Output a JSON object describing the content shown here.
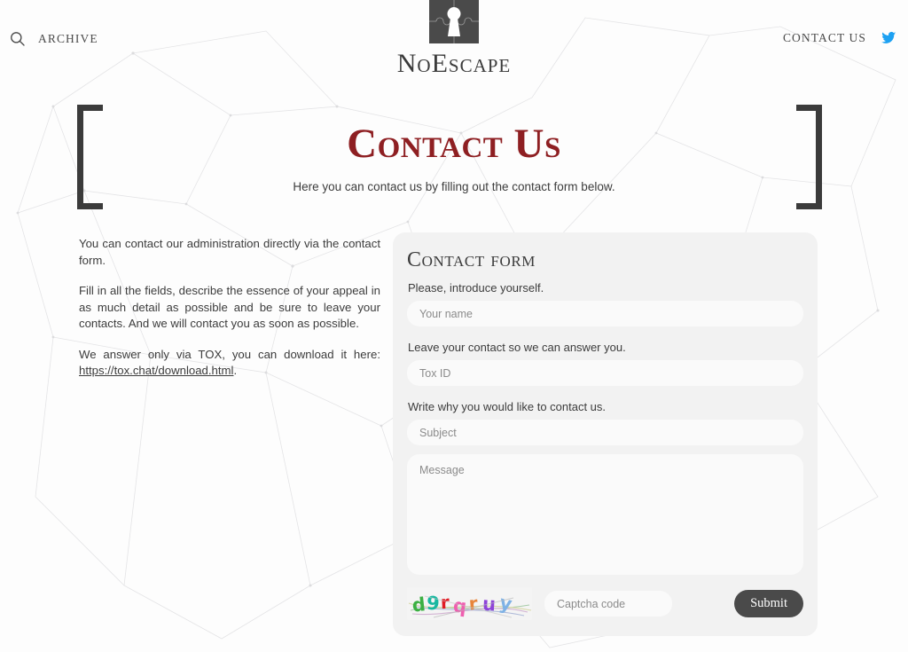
{
  "header": {
    "search_icon": "search-icon",
    "archive_label": "ARCHIVE",
    "contact_label": "CONTACT US",
    "twitter_icon": "twitter-icon",
    "logo_icon": "puzzle-keyhole-logo",
    "brand_name": "NoEscape"
  },
  "title": {
    "heading": "Contact Us",
    "subtitle": "Here you can contact us by filling out the contact form below."
  },
  "intro": {
    "paragraph1": "You can contact our administration directly via the contact form.",
    "paragraph2": "Fill in all the fields, describe the essence of your appeal in as much detail as possible and be sure to leave your contacts. And we will contact you as soon as possible.",
    "paragraph3_prefix": "We answer only via TOX, you can download it here: ",
    "link_text": "https://tox.chat/download.html",
    "paragraph3_suffix": "."
  },
  "form": {
    "title": "Contact form",
    "name_label": "Please, introduce yourself.",
    "name_placeholder": "Your name",
    "contact_label": "Leave your contact so we can answer you.",
    "contact_placeholder": "Tox ID",
    "subject_label": "Write why you would like to contact us.",
    "subject_placeholder": "Subject",
    "message_placeholder": "Message",
    "captcha_placeholder": "Captcha code",
    "captcha_text": "d9rqruy",
    "submit_label": "Submit"
  },
  "colors": {
    "title_red": "#8e1f22",
    "text_dark": "#3c3c3c",
    "card_bg": "#f2f2f2",
    "input_bg": "#fafafa",
    "submit_bg": "#4a4a4a",
    "twitter_blue": "#1da1f2",
    "logo_bg": "#4a4a4a"
  }
}
